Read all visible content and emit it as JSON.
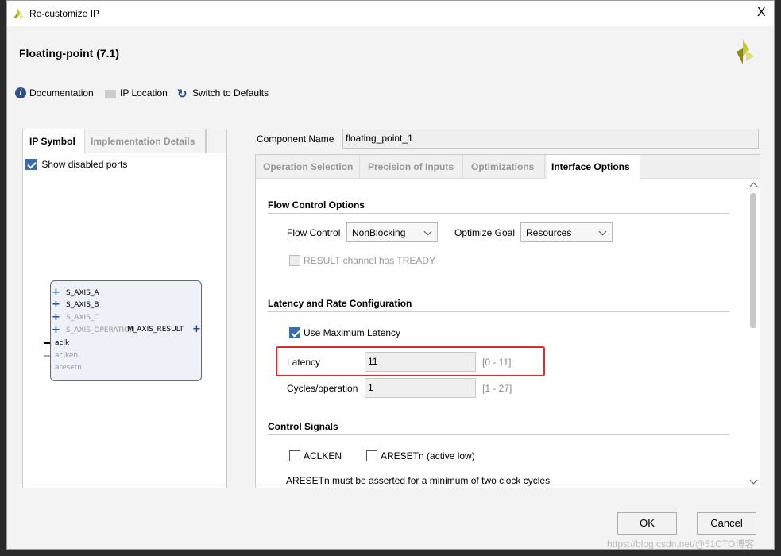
{
  "window": {
    "title": "Re-customize IP",
    "close": "X"
  },
  "header": {
    "title": "Floating-point (7.1)"
  },
  "toolbar": {
    "documentation": "Documentation",
    "ip_location": "IP Location",
    "switch_defaults": "Switch to Defaults"
  },
  "left_panel": {
    "tabs": [
      "IP Symbol",
      "Implementation Details"
    ],
    "show_disabled_ports": "Show disabled ports",
    "show_disabled_checked": true,
    "symbol": {
      "inputs": [
        "S_AXIS_A",
        "S_AXIS_B",
        "S_AXIS_C",
        "S_AXIS_OPERATION"
      ],
      "output": "M_AXIS_RESULT",
      "signals": [
        "aclk",
        "aclken",
        "aresetn"
      ]
    }
  },
  "component": {
    "label": "Component Name",
    "value": "floating_point_1"
  },
  "tabs": [
    "Operation Selection",
    "Precision of Inputs",
    "Optimizations",
    "Interface Options"
  ],
  "active_tab": "Interface Options",
  "flow": {
    "title": "Flow Control Options",
    "flow_label": "Flow Control",
    "flow_value": "NonBlocking",
    "goal_label": "Optimize Goal",
    "goal_value": "Resources",
    "tready": "RESULT channel has TREADY",
    "tready_checked": false
  },
  "latency": {
    "title": "Latency and Rate Configuration",
    "use_max": "Use Maximum Latency",
    "use_max_checked": true,
    "latency_label": "Latency",
    "latency_value": "11",
    "latency_range": "[0 - 11]",
    "cycles_label": "Cycles/operation",
    "cycles_value": "1",
    "cycles_range": "[1 - 27]"
  },
  "control": {
    "title": "Control Signals",
    "aclken": "ACLKEN",
    "aresetn": "ARESETn (active low)",
    "note": "ARESETn must be asserted for a minimum of two clock cycles"
  },
  "buttons": {
    "ok": "OK",
    "cancel": "Cancel"
  },
  "watermark": "https://blog.csdn.net/@51CTO博客",
  "colors": {
    "highlight": "#e5262a",
    "accent": "#3c6ea8"
  }
}
